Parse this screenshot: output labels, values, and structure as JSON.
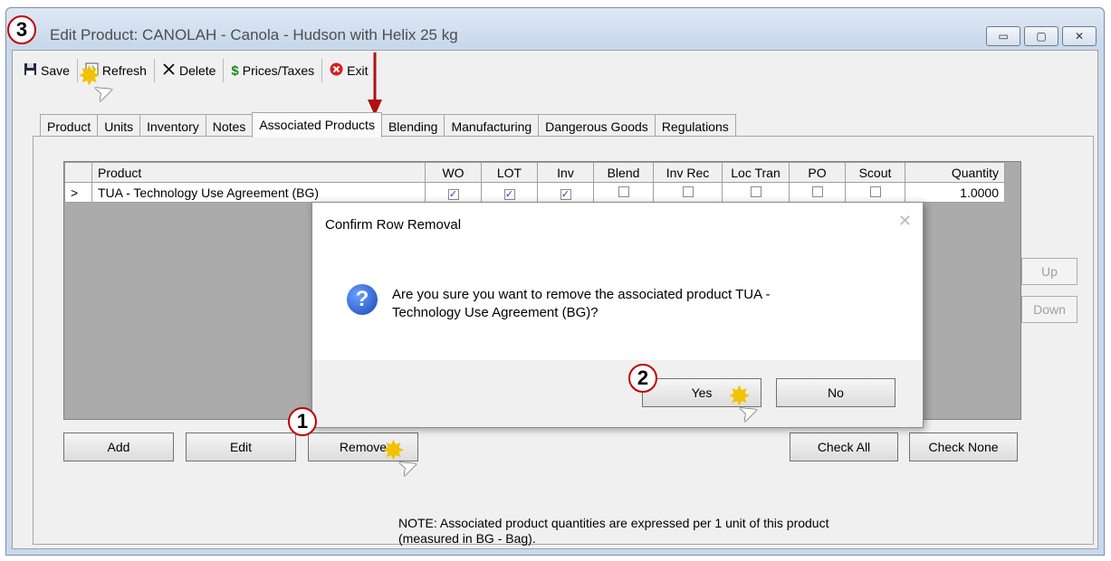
{
  "window": {
    "title": "Edit Product: CANOLAH - Canola - Hudson with Helix 25 kg",
    "controls": [
      "▭",
      "▢",
      "✕"
    ]
  },
  "toolbar": {
    "items": [
      {
        "label": "Save",
        "icon": "save-icon"
      },
      {
        "label": "Refresh",
        "icon": "refresh-icon"
      },
      {
        "label": "Delete",
        "icon": "delete-icon"
      },
      {
        "label": "Prices/Taxes",
        "icon": "dollar-icon"
      },
      {
        "label": "Exit",
        "icon": "exit-icon"
      }
    ]
  },
  "tabs": [
    "Product",
    "Units",
    "Inventory",
    "Notes",
    "Associated Products",
    "Blending",
    "Manufacturing",
    "Dangerous Goods",
    "Regulations"
  ],
  "active_tab": "Associated Products",
  "grid": {
    "columns": [
      "Product",
      "WO",
      "LOT",
      "Inv",
      "Blend",
      "Inv Rec",
      "Loc Tran",
      "PO",
      "Scout",
      "Quantity"
    ],
    "rows": [
      {
        "marker": ">",
        "product": "TUA - Technology Use Agreement (BG)",
        "wo": true,
        "lot": true,
        "inv": true,
        "blend": false,
        "inv_rec": false,
        "loc_tran": false,
        "po": false,
        "scout": false,
        "quantity": "1.0000"
      }
    ]
  },
  "side_buttons": {
    "up": "Up",
    "down": "Down"
  },
  "buttons": {
    "add": "Add",
    "edit": "Edit",
    "remove": "Remove",
    "check_all": "Check All",
    "check_none": "Check None"
  },
  "note": {
    "line1": "NOTE:  Associated product quantities are expressed per 1 unit of this product",
    "line2": "(measured in BG - Bag)."
  },
  "dialog": {
    "title": "Confirm Row Removal",
    "close": "✕",
    "icon": "question-icon",
    "message_line1": "Are you sure you want to remove the associated product TUA -",
    "message_line2": "Technology Use Agreement (BG)?",
    "yes": "Yes",
    "no": "No"
  },
  "steps": {
    "one": "1",
    "two": "2",
    "three": "3"
  },
  "colors": {
    "step_ring": "#c00000",
    "burst": "#f2c200",
    "arrow": "#b01010",
    "check": "#2044a8"
  }
}
